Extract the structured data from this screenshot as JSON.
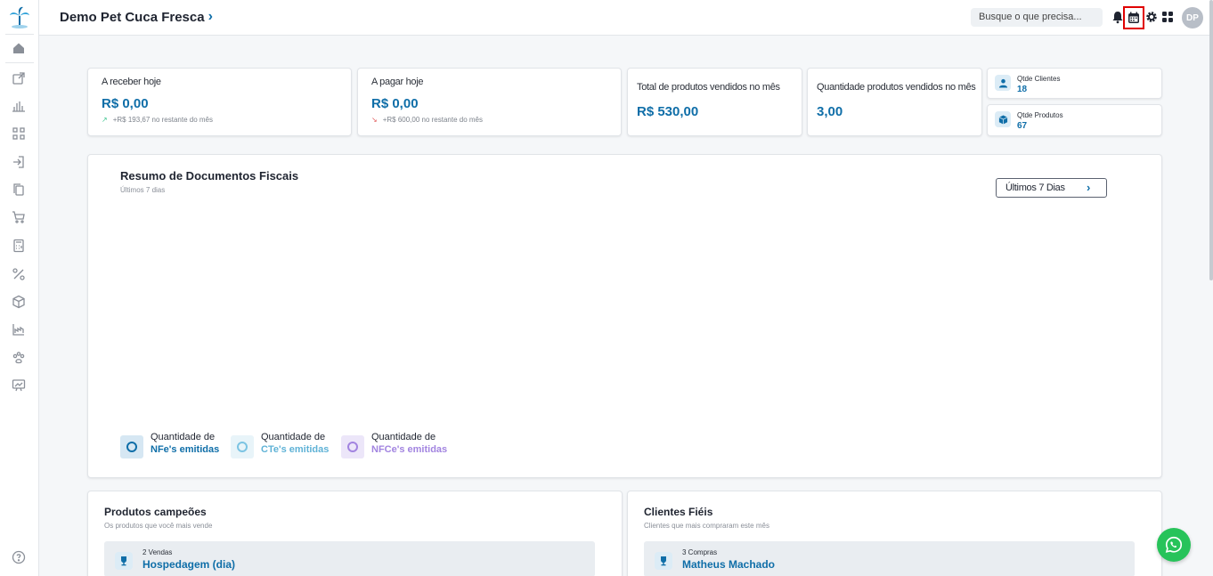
{
  "header": {
    "company_name": "Demo Pet Cuca Fresca",
    "search_placeholder": "Busque o que precisa...",
    "avatar_initials": "DP"
  },
  "kpis": [
    {
      "label": "A receber hoje",
      "value": "R$ 0,00",
      "sub": "+R$ 193,67 no restante do mês"
    },
    {
      "label": "A pagar hoje",
      "value": "R$ 0,00",
      "sub": "+R$ 600,00 no restante do mês"
    },
    {
      "label": "Total de produtos vendidos no mês",
      "value": "R$ 530,00"
    },
    {
      "label": "Quantidade produtos vendidos no mês",
      "value": "3,00"
    }
  ],
  "mini_cards": [
    {
      "label": "Qtde Clientes",
      "value": "18"
    },
    {
      "label": "Qtde Produtos",
      "value": "67"
    }
  ],
  "fiscal": {
    "title": "Resumo de Documentos Fiscais",
    "subtitle": "Últimos 7 dias",
    "period_button": "Últimos 7 Dias",
    "legend": [
      {
        "line1": "Quantidade de",
        "line2": "NFe's emitidas",
        "color": "#0f6ea8",
        "bg": "#d6e7f3"
      },
      {
        "line1": "Quantidade de",
        "line2": "CTe's emitidas",
        "color": "#7cc4e3",
        "bg": "#e8f4f9"
      },
      {
        "line1": "Quantidade de",
        "line2": "NFCe's emitidas",
        "color": "#a284e0",
        "bg": "#ece6f9"
      }
    ]
  },
  "produtos": {
    "title": "Produtos campeões",
    "subtitle": "Os produtos que você mais vende",
    "top": {
      "count": "2 Vendas",
      "name": "Hospedagem (dia)"
    }
  },
  "clientes": {
    "title": "Clientes Fiéis",
    "subtitle": "Clientes que mais compraram este mês",
    "top": {
      "count": "3 Compras",
      "name": "Matheus Machado"
    }
  },
  "colors": {
    "accent": "#0f6ea8",
    "highlight": "#e00000",
    "whatsapp": "#27c35a"
  }
}
